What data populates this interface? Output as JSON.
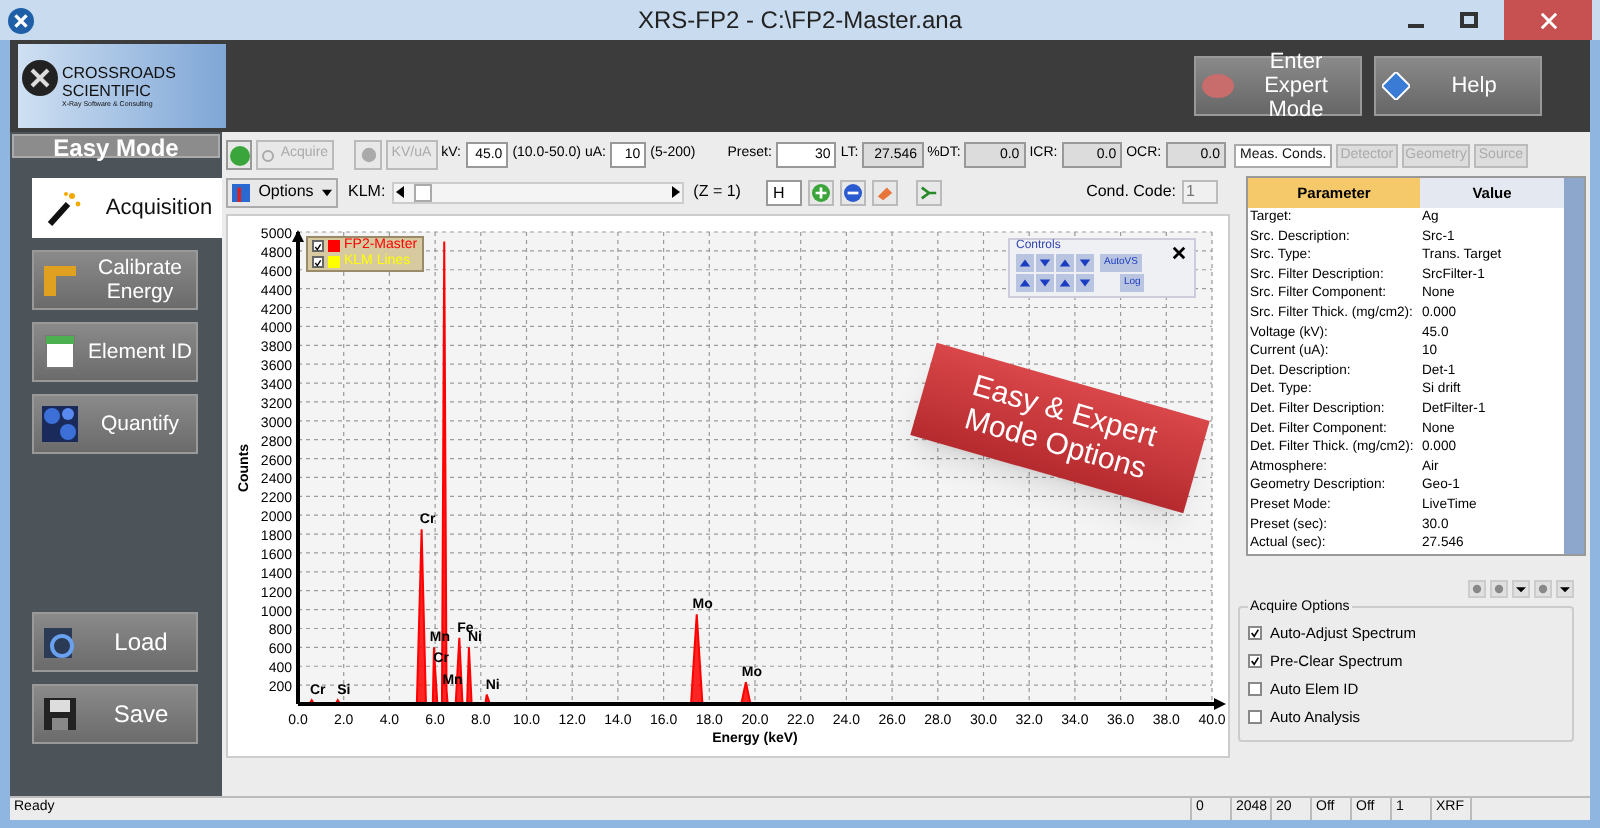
{
  "window": {
    "title": "XRS-FP2 - C:\\FP2-Master.ana"
  },
  "logo": {
    "name": "CROSSROADS SCIENTIFIC",
    "tagline": "X-Ray Software & Consulting"
  },
  "header_buttons": [
    {
      "label": "Enter Expert Mode"
    },
    {
      "label": "Help"
    }
  ],
  "sidebar": {
    "title": "Easy Mode",
    "items": [
      {
        "label": "Acquisition",
        "selected": true
      },
      {
        "label": "Calibrate Energy",
        "selected": false
      },
      {
        "label": "Element ID",
        "selected": false
      },
      {
        "label": "Quantify",
        "selected": false
      }
    ],
    "bottom_buttons": [
      {
        "label": "Load"
      },
      {
        "label": "Save"
      }
    ]
  },
  "toolbar": {
    "acquire": {
      "label": "Acquire",
      "disabled": true
    },
    "kv_ua": {
      "label": "KV/uA",
      "disabled": true
    },
    "fields": [
      {
        "label": "kV:",
        "value": "45.0",
        "note": "(10.0-50.0)",
        "readonly": false
      },
      {
        "label": "uA:",
        "value": "10",
        "note": "(5-200)",
        "readonly": false
      },
      {
        "label": "Preset:",
        "value": "30",
        "readonly": false
      },
      {
        "label": "LT:",
        "value": "27.546",
        "readonly": true
      },
      {
        "label": "%DT:",
        "value": "0.0",
        "readonly": true
      },
      {
        "label": "ICR:",
        "value": "0.0",
        "readonly": true
      },
      {
        "label": "OCR:",
        "value": "0.0",
        "readonly": true
      }
    ],
    "options": {
      "label": "Options"
    },
    "klm_label": "KLM:",
    "z_label": "(Z = 1)",
    "element": "H",
    "cond_code": {
      "label": "Cond. Code:",
      "value": "1",
      "disabled": true
    }
  },
  "legend": [
    {
      "checked": true
    },
    {
      "label": "KLM Lines",
      "checked": true,
      "color": "#ffff00"
    }
  ],
  "controls": {
    "title": "Controls",
    "autovs": "AutoVS",
    "log": "Log"
  },
  "chart_data": {
    "type": "area",
    "grid": true,
    "xlabel": "Energy (keV)",
    "ylabel": "Counts",
    "xlim": [
      0,
      40
    ],
    "ylim": [
      0,
      5000
    ],
    "x": [
      0,
      0.5,
      0.6,
      0.7,
      1.64,
      1.74,
      1.84,
      5.2,
      5.41,
      5.6,
      5.9,
      5.95,
      6.0,
      6.1,
      6.3,
      6.4,
      6.5,
      6.55,
      6.9,
      7.06,
      7.2,
      7.4,
      7.48,
      7.6,
      8.2,
      8.26,
      8.4,
      17.2,
      17.45,
      17.7,
      19.4,
      19.6,
      19.8,
      40
    ],
    "series": [
      {
        "name": "FP2-Master",
        "color": "#ff0000",
        "values": [
          0,
          0,
          40,
          0,
          0,
          40,
          0,
          0,
          1850,
          0,
          0,
          600,
          380,
          0,
          0,
          4900,
          150,
          0,
          0,
          700,
          0,
          0,
          600,
          0,
          0,
          100,
          0,
          0,
          950,
          0,
          0,
          230,
          0,
          0
        ]
      }
    ],
    "xticks": [
      {
        "value": 0,
        "label": "0.0"
      },
      {
        "value": 2,
        "label": "2.0"
      },
      {
        "value": 4,
        "label": "4.0"
      },
      {
        "value": 6,
        "label": "6.0"
      },
      {
        "value": 8,
        "label": "8.0"
      },
      {
        "value": 10,
        "label": "10.0"
      },
      {
        "value": 12,
        "label": "12.0"
      },
      {
        "value": 14,
        "label": "14.0"
      },
      {
        "value": 16,
        "label": "16.0"
      },
      {
        "value": 18,
        "label": "18.0"
      },
      {
        "value": 20,
        "label": "20.0"
      },
      {
        "value": 22,
        "label": "22.0"
      },
      {
        "value": 24,
        "label": "24.0"
      },
      {
        "value": 26,
        "label": "26.0"
      },
      {
        "value": 28,
        "label": "28.0"
      },
      {
        "value": 30,
        "label": "30.0"
      },
      {
        "value": 32,
        "label": "32.0"
      },
      {
        "value": 34,
        "label": "34.0"
      },
      {
        "value": 36,
        "label": "36.0"
      },
      {
        "value": 38,
        "label": "38.0"
      },
      {
        "value": 40,
        "label": "40.0"
      }
    ],
    "yticks": [
      200,
      400,
      600,
      800,
      1000,
      1200,
      1400,
      1600,
      1800,
      2000,
      2200,
      2400,
      2600,
      2800,
      3000,
      3200,
      3400,
      3600,
      3800,
      4000,
      4200,
      4400,
      4600,
      4800,
      5000
    ],
    "annotations": [
      {
        "text": "Cr",
        "x": 0.6,
        "y": 40
      },
      {
        "text": "Si",
        "x": 1.74,
        "y": 40
      },
      {
        "text": "Cr",
        "x": 5.41,
        "y": 1850
      },
      {
        "text": "Mn",
        "x": 5.95,
        "y": 600
      },
      {
        "text": "Cr",
        "x": 6.0,
        "y": 380
      },
      {
        "text": "Mn",
        "x": 6.5,
        "y": 150
      },
      {
        "text": "Fe",
        "x": 7.06,
        "y": 700
      },
      {
        "text": "Ni",
        "x": 7.48,
        "y": 600
      },
      {
        "text": "Ni",
        "x": 8.26,
        "y": 100
      },
      {
        "text": "Mo",
        "x": 17.45,
        "y": 950
      },
      {
        "text": "Mo",
        "x": 19.6,
        "y": 230
      }
    ]
  },
  "banner": {
    "lines": [
      "Easy & Expert",
      "Mode Options"
    ]
  },
  "tabs": [
    {
      "label": "Meas. Conds.",
      "selected": true
    },
    {
      "label": "Detector",
      "selected": false
    },
    {
      "label": "Geometry",
      "selected": false
    },
    {
      "label": "Source",
      "selected": false
    }
  ],
  "table": {
    "columns": [
      "Parameter",
      "Value"
    ],
    "rows": [
      [
        "Target:",
        "Ag"
      ],
      [
        "Src. Description:",
        "Src-1"
      ],
      [
        "Src. Type:",
        "Trans. Target"
      ],
      [
        "Src. Filter Description:",
        "SrcFilter-1"
      ],
      [
        "Src. Filter Component:",
        "None"
      ],
      [
        "Src. Filter Thick. (mg/cm2):",
        "0.000"
      ],
      [
        "Voltage (kV):",
        "45.0"
      ],
      [
        "Current (uA):",
        "10"
      ],
      [
        "Det. Description:",
        "Det-1"
      ],
      [
        "Det. Type:",
        "Si drift"
      ],
      [
        "Det. Filter Description:",
        "DetFilter-1"
      ],
      [
        "Det. Filter Component:",
        "None"
      ],
      [
        "Det. Filter Thick. (mg/cm2):",
        "0.000"
      ],
      [
        "Atmosphere:",
        "Air"
      ],
      [
        "Geometry Description:",
        "Geo-1"
      ],
      [
        "Preset Mode:",
        "LiveTime"
      ],
      [
        "Preset (sec):",
        "30.0"
      ],
      [
        "Actual (sec):",
        "27.546"
      ]
    ]
  },
  "acquire_options": {
    "title": "Acquire Options",
    "items": [
      {
        "label": "Auto-Adjust Spectrum",
        "checked": true
      },
      {
        "label": "Pre-Clear Spectrum",
        "checked": true
      },
      {
        "label": "Auto Elem ID",
        "checked": false
      },
      {
        "label": "Auto Analysis",
        "checked": false
      }
    ]
  },
  "status_bar": {
    "text": "Ready",
    "cells": [
      "0",
      "2048",
      "20",
      "Off",
      "Off",
      "1",
      "XRF"
    ]
  }
}
